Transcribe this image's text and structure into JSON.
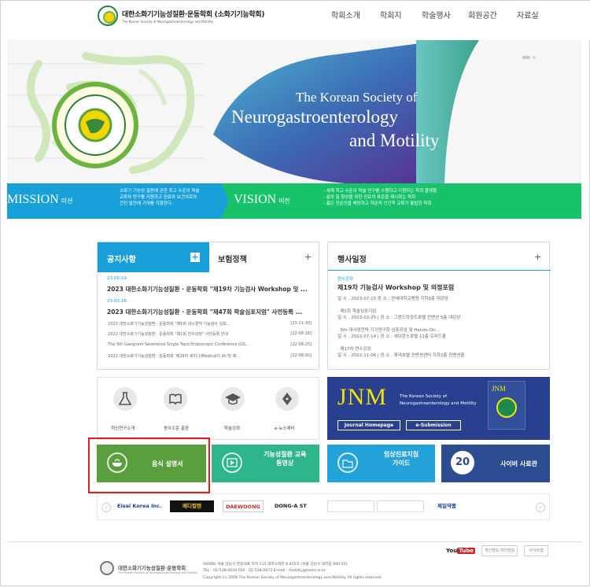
{
  "header": {
    "site_title": "대한소화기기능성질환·운동학회 (소화기기능학회)",
    "site_subtitle": "The Korean Society of Neurogastroenterology and Motility",
    "nav": [
      "학회소개",
      "학회지",
      "학술행사",
      "회원공간",
      "자료실"
    ]
  },
  "hero": {
    "line1": "The Korean Society of",
    "line2": "Neurogastroenterology",
    "line3": "and Motility"
  },
  "mission": {
    "title": "MISSION",
    "title_ko": "미션",
    "lines": [
      "소화기 기능성 질환에 관한 최고 수준의 학술",
      "교류와 연구를 지원하고 진료와 보건의료의",
      "건전 발전에 기여를 지향한다."
    ]
  },
  "vision": {
    "title": "VISION",
    "title_ko": "비전",
    "lines": [
      "- 세계 최고 수준의 학술 연구를 수행하고 지원하는 학회 플랫폼",
      "- 삶의 질 향상을 위한 진료의 표준을 제시하는 학회",
      "- 젊은 전문인을 배양하고 학문적 인간적 교류가 활발한 학회"
    ]
  },
  "notice": {
    "tab_active": "공지사항",
    "tab_other": "보험정책",
    "plus": "+",
    "items_featured": [
      {
        "date": "23-05-19",
        "title": "2023 대한소화기기능성질환 · 운동학회 \"제19차 기능검사 Workshop 및 ..."
      },
      {
        "date": "23-03-26",
        "title": "2023 대한소화기기능성질환 · 운동학회 \"제47회 학술심포지엄\" 사전등록 ..."
      }
    ],
    "items": [
      {
        "text": "· 2023 대한소화기기능성질환 · 운동학회 \"제5회 내시경적 기능검사 심포...",
        "date": "[23-11-30]"
      },
      {
        "text": "· 2022 대한소화기기능성질환 · 운동학회 \"제1회 연수강좌\" 사전등록 안내",
        "date": "[22-08-18]"
      },
      {
        "text": "· The 5th Gangnam Severance Single Topic Endoscopic Conference (GS...",
        "date": "[22-08-25]"
      },
      {
        "text": "· 2022 대한소화기기능성질환 · 운동학회 '제29차 세미나/Medical의 Ali 및 제...",
        "date": "[22-08-30]"
      }
    ]
  },
  "events": {
    "title": "행사일정",
    "plus": "+",
    "featured": {
      "label": "연수강좌",
      "title": "제19차 기능검사 Workshop 및 의정포럼",
      "info": "일 시 : 2023-07-15 장 소 : 연세대학교병원 지하3층 대강당"
    },
    "items": [
      {
        "label": "· 제5회 학술심포지엄",
        "info": "일 시 : 2023-02-25 | 장 소 : 그랜드하얏트호텔 컨벤션 5층 대강당"
      },
      {
        "label": "· 5th 대사경전략 기기연구회 심포지엄 및 Hands-On...",
        "info": "일 시 : 2022-07-14 | 장 소 : 세브란스호텔 11층 오리드홀"
      },
      {
        "label": "· 제17차 연수강좌",
        "info": "일 시 : 2022-11-06 | 장 소 : 롯데호텔 컨벤션센터 지하2층 컨벤션홀"
      }
    ]
  },
  "quick_links": [
    "최신연구소개",
    "동아꼬운 출판",
    "학술강좌",
    "e-뉴스레터"
  ],
  "jnm": {
    "logo": "JNM",
    "society": [
      "The Korean Society of",
      "Neurogastroenterology and Motility"
    ],
    "btn_home": "Journal Homepage",
    "btn_submit": "e-Submission",
    "cover_title": "JNM"
  },
  "features": {
    "food": "음식 설명서",
    "education": [
      "기능성질환 교육",
      "동영상"
    ],
    "guideline": [
      "임상진료지침",
      "가이드"
    ],
    "cyber": "사이버 사료관",
    "anniv": "20"
  },
  "sponsors": [
    "Eisai Korea Inc.",
    "메디컬텐",
    "DAEWOONG",
    "DONG-A ST",
    "",
    "",
    "제일약품"
  ],
  "footer": {
    "society_name": "대한소화기기능성질환·운동학회",
    "society_sub": "The Korean Society of Neurogastroenterology and Motility",
    "address": "06089) 서울 강남구 영동대로 지하 115 대학소회관 8  815호 (서울 강남구 대치동 890-55)",
    "contact": "TEL : 02-538-0634  FAX : 02-538-0672  E-mail : motility@kams.or.kr",
    "copyright": "Copyright (c) 2008 The Korean Society of Neurogastroenterology and Motility. All rights reserved.",
    "youtube": "You Tube",
    "btn_privacy": "개인정보 처리방침",
    "btn_sitemap": "사이트맵"
  },
  "colors": {
    "mission_blue": "#1aa0d8",
    "vision_green": "#18c26a",
    "food_green": "#5a9e3e",
    "edu_green": "#2eb58c",
    "guide_blue": "#23a3d9",
    "cyber_navy": "#2b4c91",
    "jnm_navy": "#28408f",
    "highlight_red": "#e02020"
  }
}
